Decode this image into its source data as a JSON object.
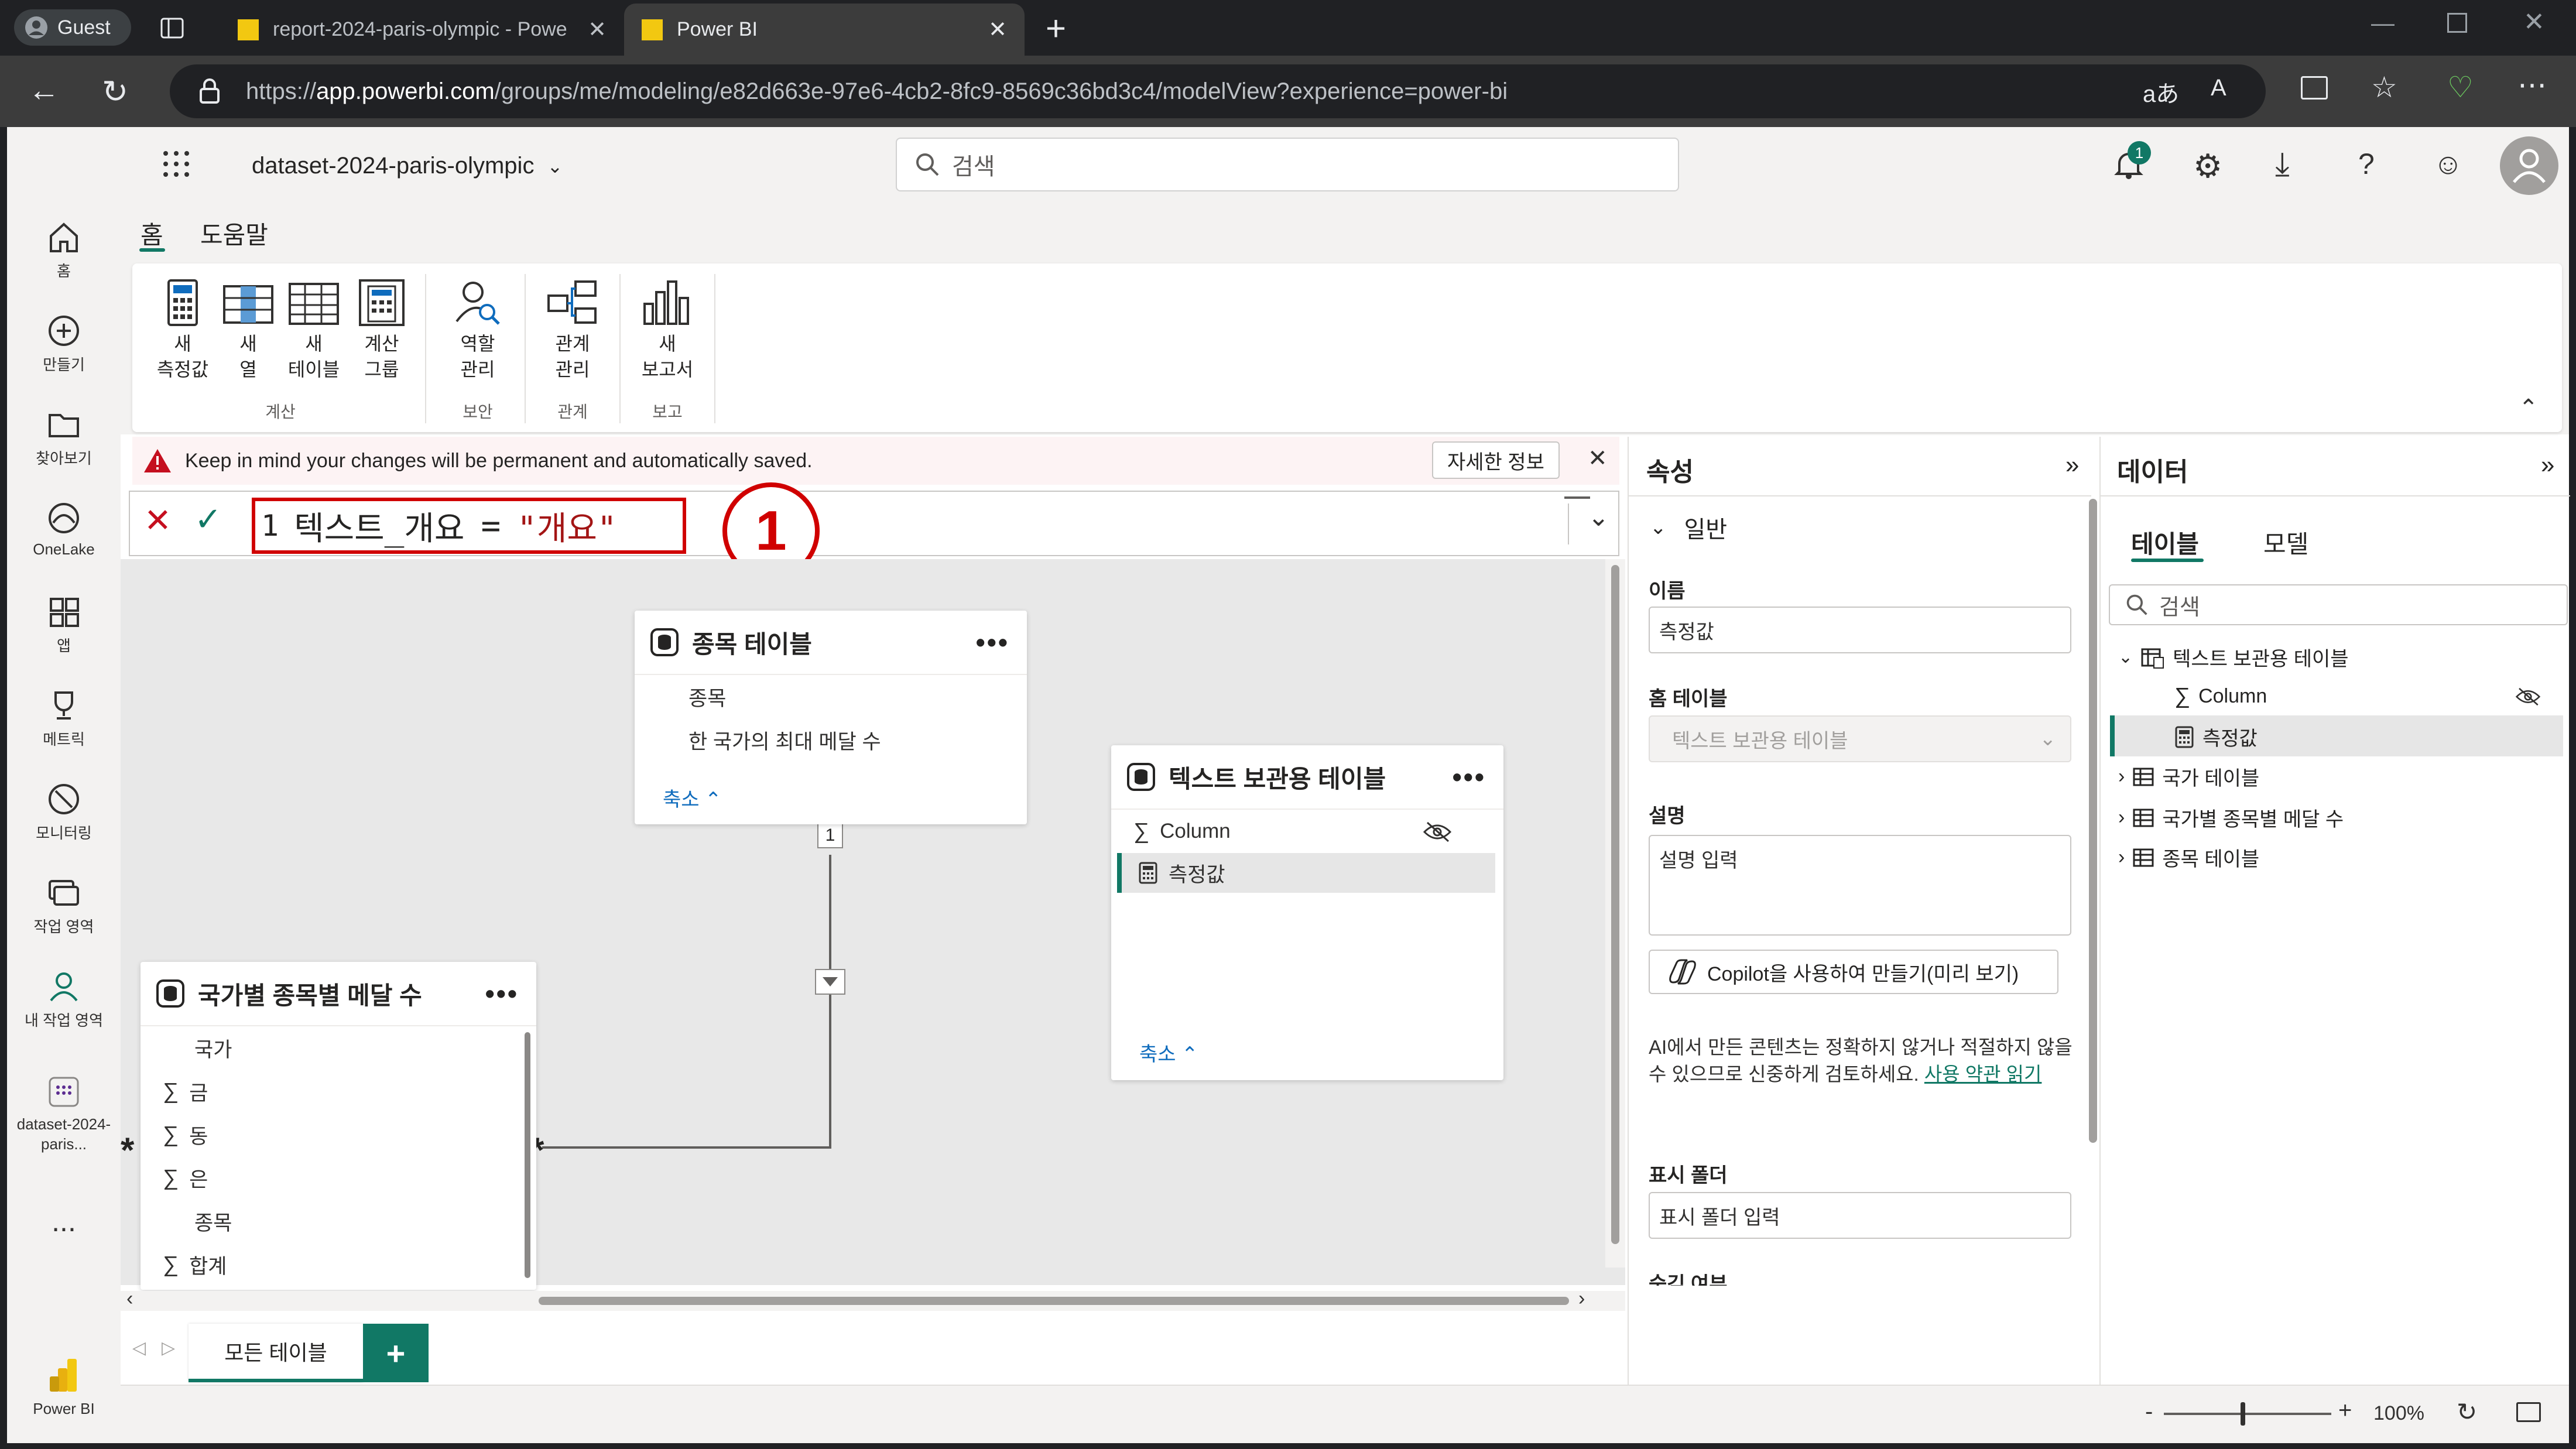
{
  "browser": {
    "guest_label": "Guest",
    "tabs": [
      {
        "title": "report-2024-paris-olympic - Powe"
      },
      {
        "title": "Power BI"
      }
    ],
    "url_prefix": "https://",
    "url_host": "app.powerbi.com",
    "url_path": "/groups/me/modeling/e82d663e-97e6-4cb2-8fc9-8569c36bd3c4/modelView?experience=power-bi"
  },
  "app": {
    "dataset_name": "dataset-2024-paris-olympic",
    "search_placeholder": "검색",
    "notification_count": "1"
  },
  "leftnav": {
    "items": [
      {
        "label": "홈"
      },
      {
        "label": "만들기"
      },
      {
        "label": "찾아보기"
      },
      {
        "label": "OneLake"
      },
      {
        "label": "앱"
      },
      {
        "label": "메트릭"
      },
      {
        "label": "모니터링"
      },
      {
        "label": "작업 영역"
      },
      {
        "label": "내 작업 영역"
      },
      {
        "label": "dataset-2024-paris..."
      }
    ],
    "more": "...",
    "brand": "Power BI"
  },
  "ribbon": {
    "tabs": [
      {
        "label": "홈"
      },
      {
        "label": "도움말"
      }
    ],
    "buttons": [
      {
        "line1": "새",
        "line2": "측정값"
      },
      {
        "line1": "새",
        "line2": "열"
      },
      {
        "line1": "새",
        "line2": "테이블"
      },
      {
        "line1": "계산",
        "line2": "그룹"
      },
      {
        "line1": "역할",
        "line2": "관리"
      },
      {
        "line1": "관계",
        "line2": "관리"
      },
      {
        "line1": "새",
        "line2": "보고서"
      }
    ],
    "groups": [
      {
        "label": "계산"
      },
      {
        "label": "보안"
      },
      {
        "label": "관계"
      },
      {
        "label": "보고"
      }
    ]
  },
  "warning": {
    "text": "Keep in mind your changes will be permanent and automatically saved.",
    "more_button": "자세한 정보"
  },
  "formula": {
    "line_number": "1",
    "expression_name": "텍스트_개요",
    "operator": "=",
    "value": "\"개요\"",
    "annotation": "1"
  },
  "canvas": {
    "tables": {
      "events": {
        "title": "종목 테이블",
        "fields": [
          "종목",
          "한 국가의 최대 메달 수"
        ],
        "collapse": "축소"
      },
      "text_storage": {
        "title": "텍스트 보관용 테이블",
        "fields": [
          "Column",
          "측정값"
        ],
        "collapse": "축소"
      },
      "country_medals": {
        "title": "국가별 종목별 메달 수",
        "fields": [
          "국가",
          "금",
          "동",
          "은",
          "종목",
          "합계"
        ]
      }
    },
    "relationship": {
      "one": "1",
      "many": "*"
    },
    "sheet_tab": "모든 테이블",
    "add_sheet": "+"
  },
  "properties": {
    "title": "속성",
    "section": "일반",
    "name_label": "이름",
    "name_value": "측정값",
    "home_table_label": "홈 테이블",
    "home_table_value": "텍스트 보관용 테이블",
    "description_label": "설명",
    "description_placeholder": "설명 입력",
    "copilot_button": "Copilot을 사용하여 만들기(미리 보기)",
    "ai_notice": "AI에서 만든 콘텐츠는 정확하지 않거나 적절하지 않을 수 있으므로 신중하게 검토하세요.",
    "terms_link": "사용 약관 읽기",
    "display_folder_label": "표시 폴더",
    "display_folder_placeholder": "표시 폴더 입력",
    "hidden_label": "숨김 여부"
  },
  "data_pane": {
    "title": "데이터",
    "tabs": [
      {
        "label": "테이블"
      },
      {
        "label": "모델"
      }
    ],
    "search_placeholder": "검색",
    "tree": [
      {
        "label": "텍스트 보관용 테이블"
      },
      {
        "label": "Column"
      },
      {
        "label": "측정값"
      },
      {
        "label": "국가 테이블"
      },
      {
        "label": "국가별 종목별 메달 수"
      },
      {
        "label": "종목 테이블"
      }
    ]
  },
  "status": {
    "zoom": "100%",
    "zoom_value_percent": 100
  },
  "colors": {
    "accent": "#117865",
    "brand_yellow": "#f2c811",
    "warning_red": "#c50f1f",
    "annotation_red": "#d00000"
  }
}
